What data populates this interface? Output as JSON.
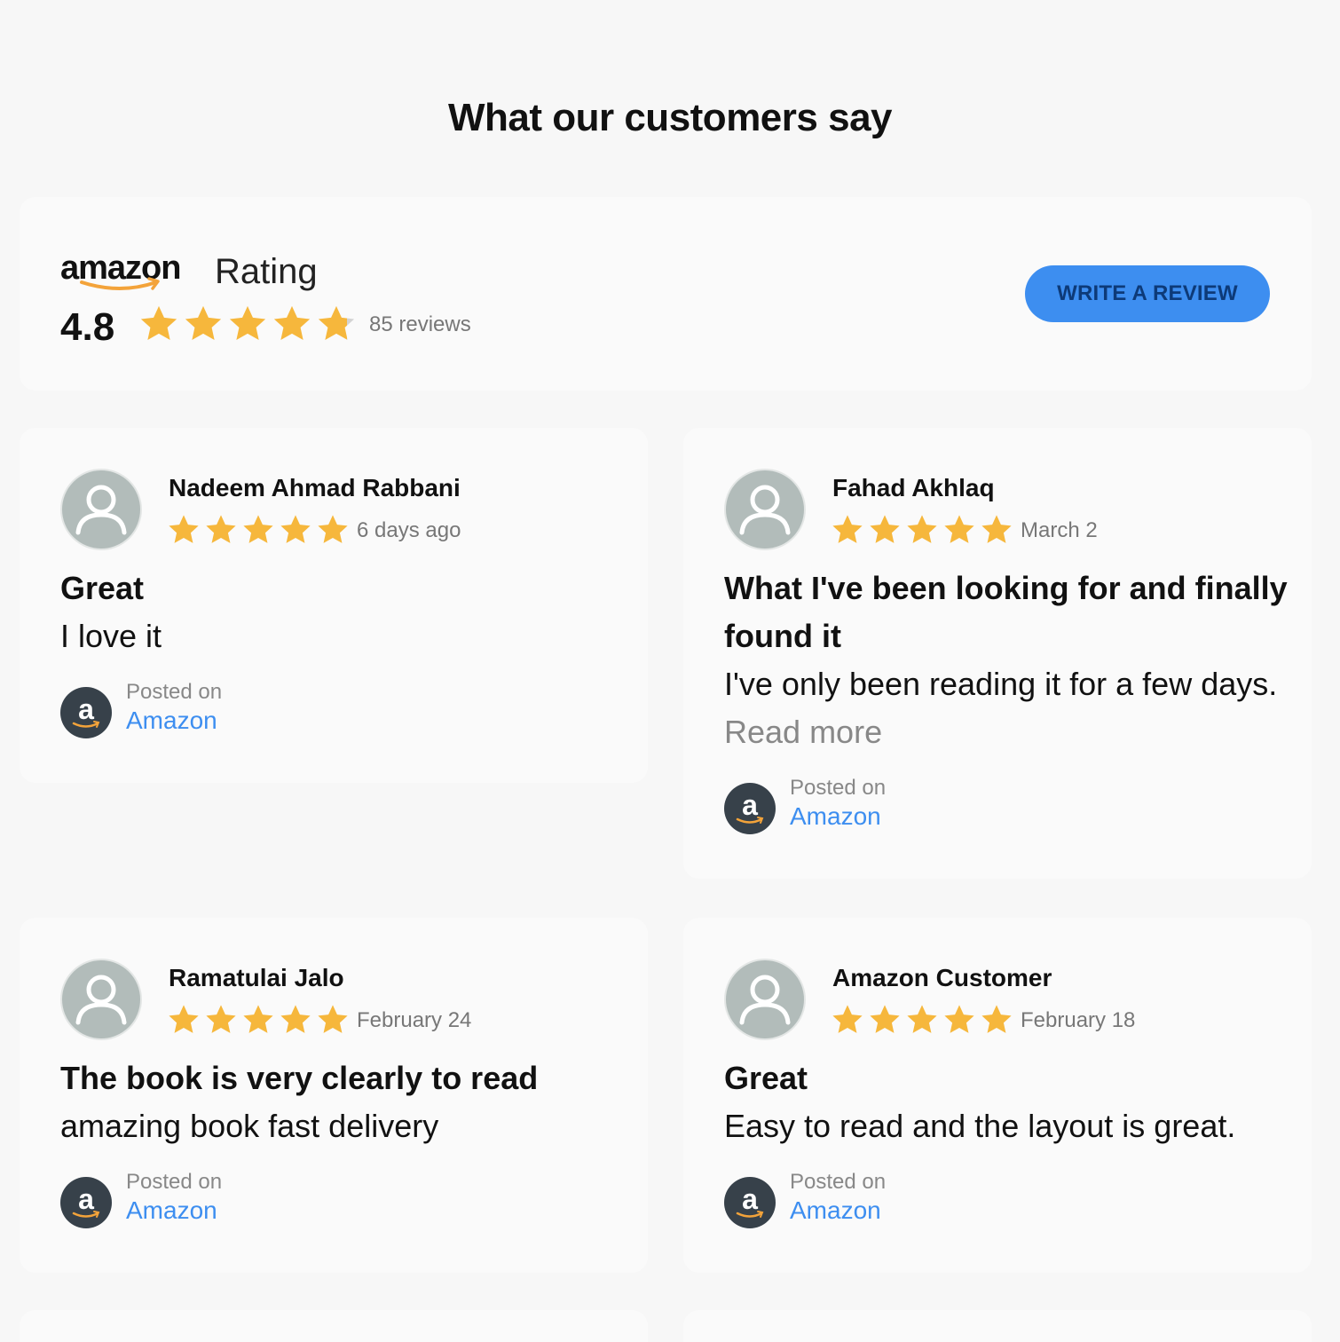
{
  "heading": "What our customers say",
  "summary": {
    "brand": "amazon",
    "rating_label": "Rating",
    "score": "4.8",
    "stars": 4.8,
    "review_count": "85 reviews",
    "write_button": "WRITE A REVIEW"
  },
  "colors": {
    "star": "#f6b73c",
    "accent": "#3d8ef0",
    "avatar": "#b2bcba",
    "amazon_badge": "#37414a",
    "amazon_smile": "#f3a33a"
  },
  "posted_label": "Posted on",
  "posted_platform": "Amazon",
  "reviews": [
    {
      "name": "Nadeem Ahmad Rabbani",
      "stars": 5,
      "date": "6 days ago",
      "title": "Great",
      "body": "I love it",
      "read_more": ""
    },
    {
      "name": "Fahad Akhlaq",
      "stars": 5,
      "date": "March 2",
      "title_line1": "What I've been looking for and finally",
      "title_line2": "found it",
      "body": "I've only been reading it for a few days.",
      "read_more": "Read more"
    },
    {
      "name": "Ramatulai Jalo",
      "stars": 5,
      "date": "February 24",
      "title": "The book is very clearly to read",
      "body": "amazing book fast delivery",
      "read_more": ""
    },
    {
      "name": "Amazon Customer",
      "stars": 5,
      "date": "February 18",
      "title": "Great",
      "body": "Easy to read and the layout is great.",
      "read_more": ""
    }
  ]
}
